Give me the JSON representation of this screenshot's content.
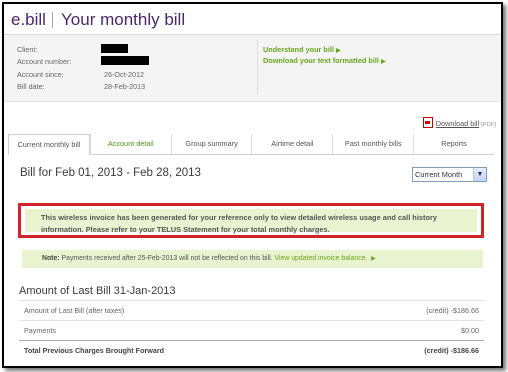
{
  "header": {
    "brand": "e.bill",
    "title": "Your monthly bill"
  },
  "account": {
    "client_label": "Client:",
    "account_number_label": "Account number:",
    "account_since_label": "Account since:",
    "account_since": "26-Oct-2012",
    "bill_date_label": "Bill date:",
    "bill_date": "28-Feb-2013"
  },
  "links": {
    "understand": "Understand your bill",
    "download_text": "Download your text formatted bill"
  },
  "download": {
    "label": "Download bill",
    "tag": "[PDF]"
  },
  "tabs": [
    {
      "label": "Current monthly bill"
    },
    {
      "label": "Account detail"
    },
    {
      "label": "Group summary"
    },
    {
      "label": "Airtime detail"
    },
    {
      "label": "Past monthly bills"
    },
    {
      "label": "Reports"
    }
  ],
  "bill_period": "Bill for Feb 01, 2013 - Feb 28, 2013",
  "period_select": {
    "selected": "Current Month"
  },
  "notice": "This wireless invoice has been generated for your reference only to view detailed wireless usage and call history information. Please refer to your TELUS Statement for your total monthly charges.",
  "note": {
    "label": "Note:",
    "text": " Payments received after 25-Feb-2013 will not be reflected on this bill. ",
    "link": "View updated invoice balance."
  },
  "section": {
    "title": "Amount of Last Bill 31-Jan-2013",
    "rows": [
      {
        "label": "Amount of Last Bill (after taxes)",
        "value": "(credit) -$186.66"
      },
      {
        "label": "Payments",
        "value": "$0.00"
      },
      {
        "label": "Total Previous Charges Brought Forward",
        "value": "(credit) -$186.66"
      }
    ]
  },
  "colors": {
    "brand": "#4b286d",
    "accent": "#66a81c",
    "highlight": "#d2232a",
    "notice_bg": "#e9f3cf"
  }
}
